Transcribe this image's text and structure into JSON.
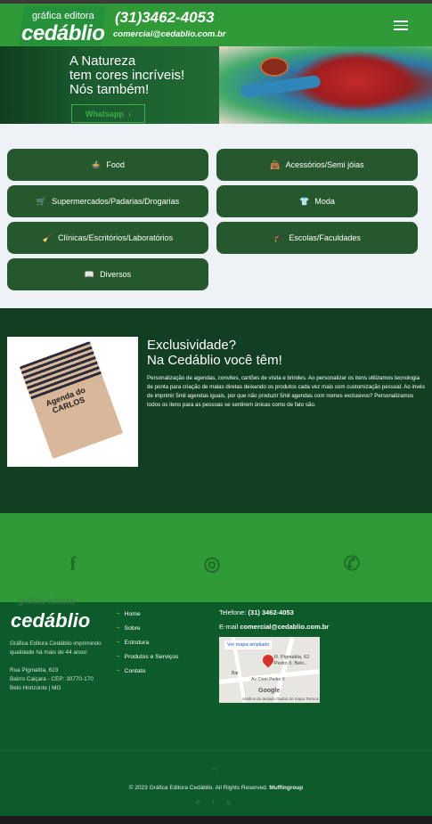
{
  "header": {
    "logo_top": "gráfica editora",
    "logo_main": "cedáblio",
    "phone": "(31)3462-4053",
    "email": "comercial@cedablio.com.br",
    "menu_icon": "hamburger-icon"
  },
  "hero": {
    "line1": "A Natureza",
    "line2": "tem cores incríveis!",
    "line3": "Nós também!",
    "whatsapp_label": "Whatsapp",
    "whatsapp_chevron": "›"
  },
  "categories": [
    {
      "label": "Food",
      "icon": "food-icon",
      "glyph": "🍲"
    },
    {
      "label": "Acessórios/Semi jóias",
      "icon": "bag-icon",
      "glyph": "👜"
    },
    {
      "label": "Supermercados/Padarias/Drogarias",
      "icon": "cart-icon",
      "glyph": "🛒"
    },
    {
      "label": "Moda",
      "icon": "shirt-icon",
      "glyph": "👕"
    },
    {
      "label": "Clínicas/Escritórios/Laboratórios",
      "icon": "broom-icon",
      "glyph": "🧹"
    },
    {
      "label": "Escolas/Faculdades",
      "icon": "graduation-icon",
      "glyph": "🎓"
    },
    {
      "label": "Diversos",
      "icon": "book-icon",
      "glyph": "📖"
    }
  ],
  "exclusive": {
    "title1": "Exclusividade?",
    "title2": "Na Cedáblio você têm!",
    "text": "Personalização de agendas, convites, cartões de visita e brindes. Ao personalizar os itens utilizamos tecnologia de ponta para criação de malas diretas deixando os produtos cada vez mais com customização pessoal. Ao invés de imprimir 5mil agendas iguais, por que não produzir 5mil agendas com nomes exclusivos? Personalizamos todos os itens para as pessoas se sentirem únicas como de fato são.",
    "book_label1": "Agenda do",
    "book_label2": "CARLOS"
  },
  "social": {
    "facebook": "f",
    "instagram": "◎",
    "whatsapp": "✆"
  },
  "footer": {
    "logo_top": "gráfica editora",
    "logo_main": "cedáblio",
    "desc": "Gráfica Editora Cedáblio imprimindo qualidade há mais de 44 anos!",
    "addr1": "Rua Pigmatita, 623",
    "addr2": "Bairro Caiçara - CEP: 30770-170",
    "addr3": "Belo Horizonte | MG",
    "links": [
      "Home",
      "Sobre",
      "Estrutura",
      "Produtos e Serviços",
      "Contato"
    ],
    "phone_label": "Telefone:",
    "phone_value": "(31) 3462-4053",
    "email_label": "E-mail",
    "email_value": "comercial@cedablio.com.br",
    "map_link": "Ver mapa ampliado",
    "map_pin_label1": "R. Pigmatita, 62",
    "map_pin_label2": "Pedro II, Belo...",
    "map_bar": "Bar",
    "map_street": "Av. Dom Pedro II",
    "map_brand": "Google",
    "map_footer": "Atalhos do teclado   Dados do mapa   Termos",
    "copyright_pre": "© 2023 Gráfica Editora Cedáblio. All Rights Reserved. ",
    "copyright_brand": "Muffingroup",
    "mini_social": "✆ f ◎"
  },
  "colors": {
    "header_green": "#2f9a37",
    "button_green": "#25582c",
    "dark_green": "#123f22",
    "footer_green": "#0d5a2a"
  }
}
